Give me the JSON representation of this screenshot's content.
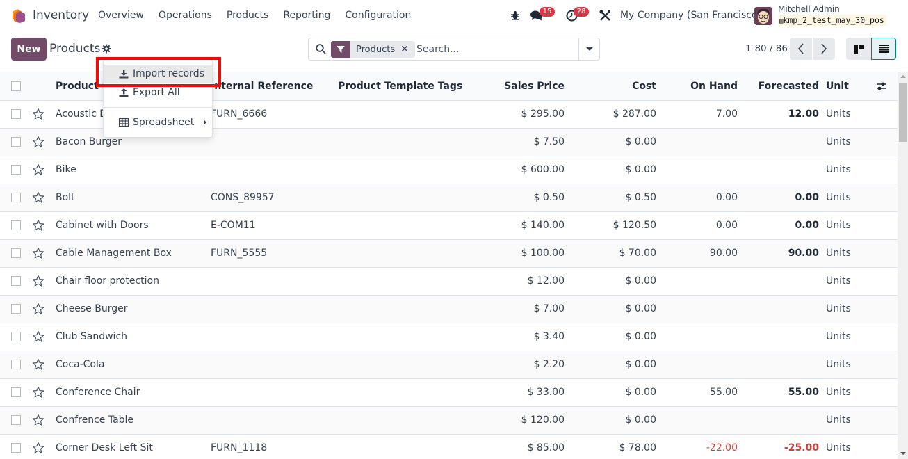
{
  "navbar": {
    "app_name": "Inventory",
    "menu": [
      "Overview",
      "Operations",
      "Products",
      "Reporting",
      "Configuration"
    ],
    "messages_count": "15",
    "activities_count": "28",
    "company": "My Company (San Francisco)",
    "user_name": "Mitchell Admin",
    "database": "kmp_2_test_may_30_pos",
    "badge_color": "#dc3545"
  },
  "control_panel": {
    "new_label": "New",
    "breadcrumb": "Products",
    "search": {
      "facet_label": "Products",
      "placeholder": "Search..."
    },
    "pager": "1-80 / 86"
  },
  "dropdown": {
    "items": [
      {
        "label": "Import records",
        "icon": "download-icon"
      },
      {
        "label": "Export All",
        "icon": "upload-icon"
      },
      {
        "label": "Spreadsheet",
        "icon": "table-icon"
      }
    ]
  },
  "table": {
    "columns": [
      "Product Name",
      "Internal Reference",
      "Product Template Tags",
      "Sales Price",
      "Cost",
      "On Hand",
      "Forecasted",
      "Unit"
    ],
    "rows": [
      {
        "name": "Acoustic Bloc Screens",
        "ref": "FURN_6666",
        "tags": "",
        "price": "$ 295.00",
        "cost": "$ 287.00",
        "on_hand": "7.00",
        "forecasted": "12.00",
        "unit": "Units",
        "negative": false
      },
      {
        "name": "Bacon Burger",
        "ref": "",
        "tags": "",
        "price": "$ 7.50",
        "cost": "$ 0.00",
        "on_hand": "",
        "forecasted": "",
        "unit": "Units",
        "negative": false
      },
      {
        "name": "Bike",
        "ref": "",
        "tags": "",
        "price": "$ 600.00",
        "cost": "$ 0.00",
        "on_hand": "",
        "forecasted": "",
        "unit": "Units",
        "negative": false
      },
      {
        "name": "Bolt",
        "ref": "CONS_89957",
        "tags": "",
        "price": "$ 0.50",
        "cost": "$ 0.50",
        "on_hand": "0.00",
        "forecasted": "0.00",
        "unit": "Units",
        "negative": false
      },
      {
        "name": "Cabinet with Doors",
        "ref": "E-COM11",
        "tags": "",
        "price": "$ 140.00",
        "cost": "$ 120.50",
        "on_hand": "0.00",
        "forecasted": "0.00",
        "unit": "Units",
        "negative": false
      },
      {
        "name": "Cable Management Box",
        "ref": "FURN_5555",
        "tags": "",
        "price": "$ 100.00",
        "cost": "$ 70.00",
        "on_hand": "90.00",
        "forecasted": "90.00",
        "unit": "Units",
        "negative": false
      },
      {
        "name": "Chair floor protection",
        "ref": "",
        "tags": "",
        "price": "$ 12.00",
        "cost": "$ 0.00",
        "on_hand": "",
        "forecasted": "",
        "unit": "Units",
        "negative": false
      },
      {
        "name": "Cheese Burger",
        "ref": "",
        "tags": "",
        "price": "$ 7.00",
        "cost": "$ 0.00",
        "on_hand": "",
        "forecasted": "",
        "unit": "Units",
        "negative": false
      },
      {
        "name": "Club Sandwich",
        "ref": "",
        "tags": "",
        "price": "$ 3.40",
        "cost": "$ 0.00",
        "on_hand": "",
        "forecasted": "",
        "unit": "Units",
        "negative": false
      },
      {
        "name": "Coca-Cola",
        "ref": "",
        "tags": "",
        "price": "$ 2.20",
        "cost": "$ 0.00",
        "on_hand": "",
        "forecasted": "",
        "unit": "Units",
        "negative": false
      },
      {
        "name": "Conference Chair",
        "ref": "",
        "tags": "",
        "price": "$ 33.00",
        "cost": "$ 0.00",
        "on_hand": "55.00",
        "forecasted": "55.00",
        "unit": "Units",
        "negative": false
      },
      {
        "name": "Confrence Table",
        "ref": "",
        "tags": "",
        "price": "$ 120.00",
        "cost": "$ 0.00",
        "on_hand": "",
        "forecasted": "",
        "unit": "Units",
        "negative": false
      },
      {
        "name": "Corner Desk Left Sit",
        "ref": "FURN_1118",
        "tags": "",
        "price": "$ 85.00",
        "cost": "$ 78.00",
        "on_hand": "-22.00",
        "forecasted": "-25.00",
        "unit": "Units",
        "negative": true
      }
    ]
  }
}
